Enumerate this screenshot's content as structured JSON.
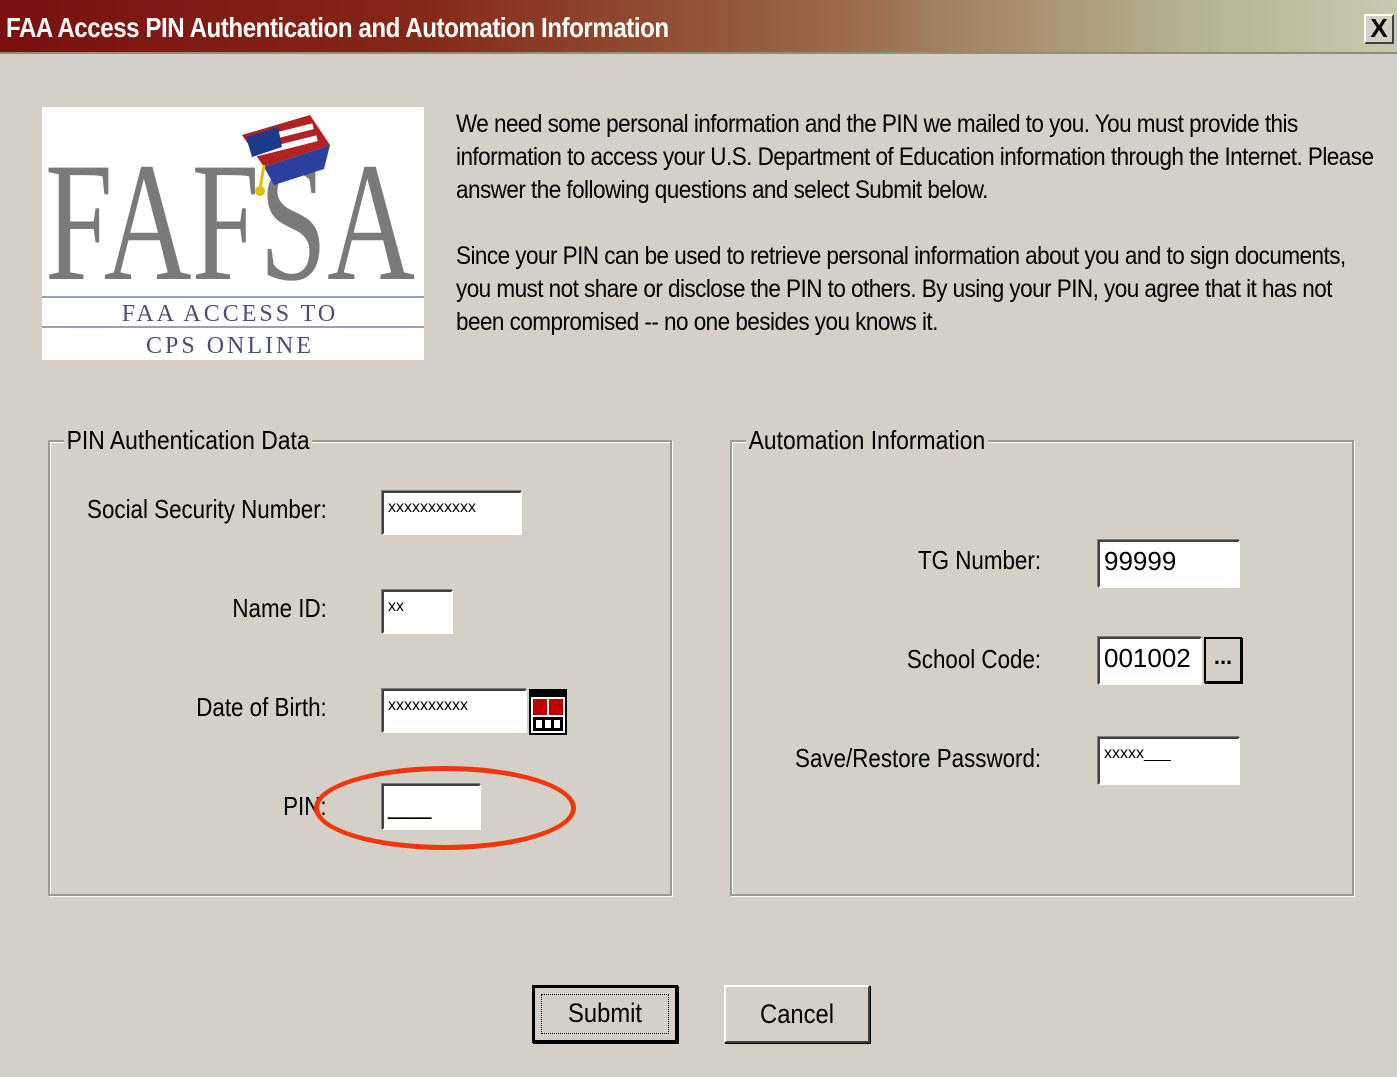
{
  "window": {
    "title": "FAA Access PIN Authentication and Automation Information",
    "close_label": "X"
  },
  "logo": {
    "brand": "FAFSA",
    "line1": "FAA ACCESS TO",
    "line2": "CPS ONLINE"
  },
  "intro": {
    "paragraph1": "We need some personal information and the PIN we mailed to you. You must provide this information to access your U.S. Department of Education information through the Internet. Please answer the following questions and select Submit below.",
    "paragraph2": "Since your PIN can be used to retrieve personal information about you and to sign documents, you must not share or disclose the PIN to others. By using your PIN, you agree that it has not been compromised -- no one besides you knows it."
  },
  "pin_group": {
    "legend": "PIN Authentication Data",
    "ssn": {
      "label": "Social Security Number:",
      "value": "xxxxxxxxxxx"
    },
    "name_id": {
      "label": "Name ID:",
      "value": "xx"
    },
    "dob": {
      "label": "Date of Birth:",
      "value": "xxxxxxxxxx"
    },
    "pin": {
      "label": "PIN:",
      "value": "___"
    }
  },
  "automation_group": {
    "legend": "Automation Information",
    "tg_number": {
      "label": "TG Number:",
      "value": "99999"
    },
    "school_code": {
      "label": "School Code:",
      "value": "001002",
      "browse_label": "..."
    },
    "password": {
      "label": "Save/Restore Password:",
      "value": "xxxxx___"
    }
  },
  "buttons": {
    "submit": "Submit",
    "cancel": "Cancel"
  },
  "colors": {
    "highlight_ring": "#f0360a",
    "dialog_bg": "#d4d0c8",
    "title_start": "#7a1010"
  }
}
